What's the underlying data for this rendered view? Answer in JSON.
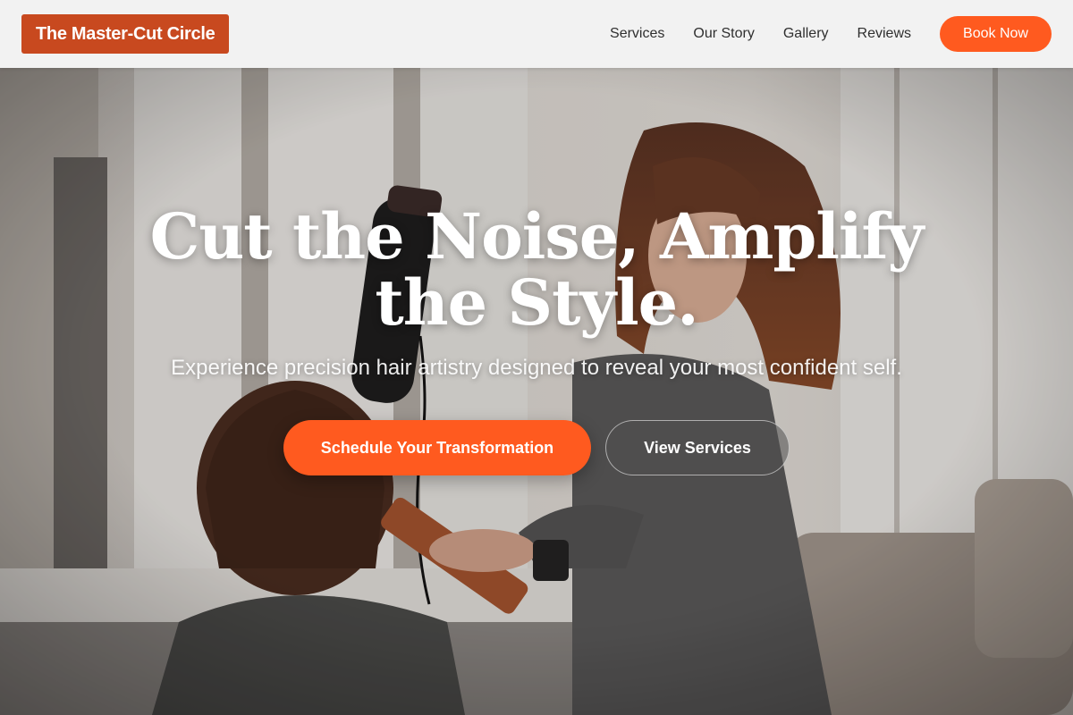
{
  "brand": {
    "name": "The Master-Cut Circle",
    "accent": "#c8491f"
  },
  "nav": {
    "items": [
      {
        "label": "Services"
      },
      {
        "label": "Our Story"
      },
      {
        "label": "Gallery"
      },
      {
        "label": "Reviews"
      }
    ],
    "cta_label": "Book Now",
    "cta_color": "#ff5a1f"
  },
  "hero": {
    "title_line1": "Cut the Noise, Amplify",
    "title_line2": "the Style.",
    "subtitle": "Experience precision hair artistry designed to reveal your most confident self.",
    "primary_cta": "Schedule Your Transformation",
    "secondary_cta": "View Services",
    "background_icon": "salon-stylist-photo"
  }
}
